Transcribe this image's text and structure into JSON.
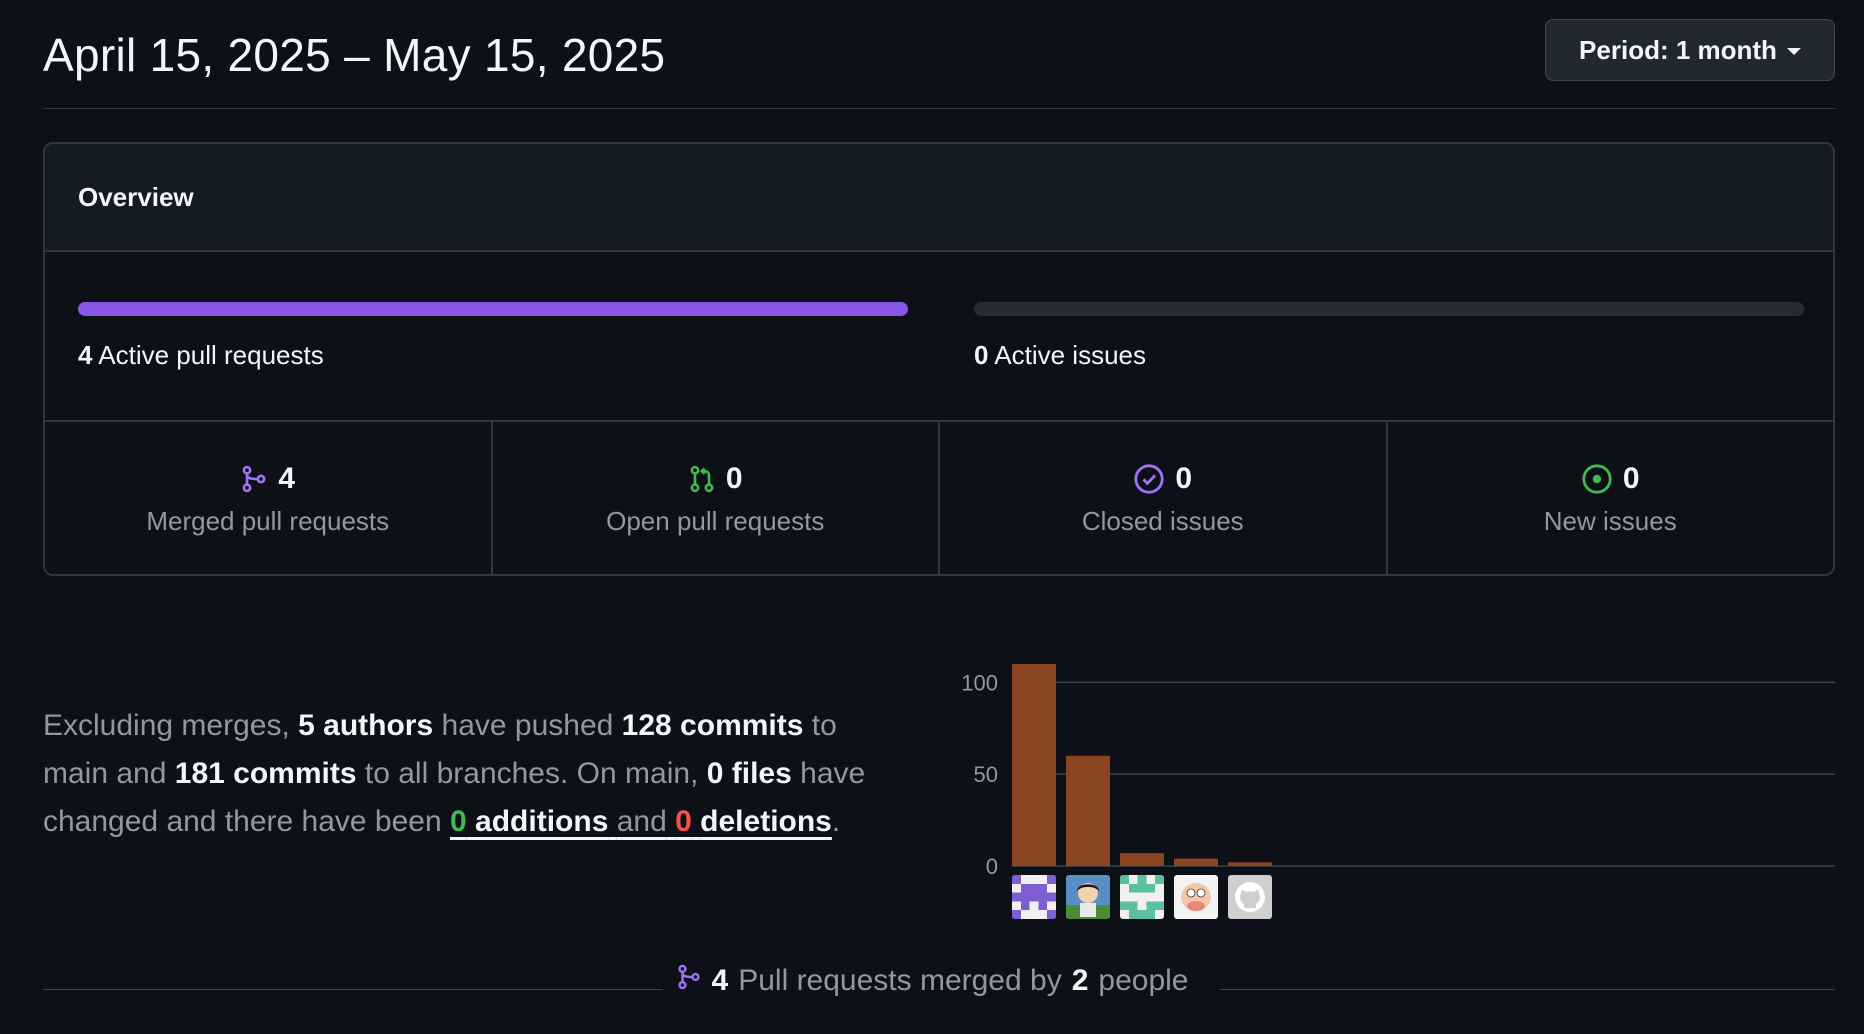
{
  "header": {
    "date_range": "April 15, 2025 – May 15, 2025",
    "period_label": "Period: 1 month"
  },
  "overview": {
    "title": "Overview",
    "pull_requests": {
      "count": "4",
      "label": "Active pull requests",
      "fill_fraction": 1.0,
      "color": "#8957e5"
    },
    "issues": {
      "count": "0",
      "label": "Active issues",
      "fill_fraction": 0.0
    },
    "stats": [
      {
        "icon": "git-merge-icon",
        "count": "4",
        "label": "Merged pull requests",
        "color": "#a371f7"
      },
      {
        "icon": "git-pull-request-icon",
        "count": "0",
        "label": "Open pull requests",
        "color": "#3fb950"
      },
      {
        "icon": "issue-closed-icon",
        "count": "0",
        "label": "Closed issues",
        "color": "#a371f7"
      },
      {
        "icon": "issue-opened-icon",
        "count": "0",
        "label": "New issues",
        "color": "#3fb950"
      }
    ]
  },
  "summary": {
    "p1": "Excluding merges,",
    "authors": "5 authors",
    "p2": "have pushed",
    "commits_main": "128 commits",
    "p3": "to main and",
    "commits_all": "181 commits",
    "p4": "to all branches. On main,",
    "files": "0 files",
    "p5": "have changed and there have been",
    "additions_count": "0",
    "additions_word": "additions",
    "p6": "and",
    "deletions_count": "0",
    "deletions_word": "deletions",
    "p7": "."
  },
  "chart_data": {
    "type": "bar",
    "categories": [
      "contributor-1",
      "contributor-2",
      "contributor-3",
      "contributor-4",
      "contributor-5"
    ],
    "values": [
      110,
      60,
      7,
      4,
      2
    ],
    "ylim": [
      0,
      110
    ],
    "yticks": [
      0,
      50,
      100
    ],
    "grid": true,
    "bar_color": "#8b4420"
  },
  "footer": {
    "count": "4",
    "mid": "Pull requests merged by",
    "people_count": "2",
    "end": "people"
  }
}
